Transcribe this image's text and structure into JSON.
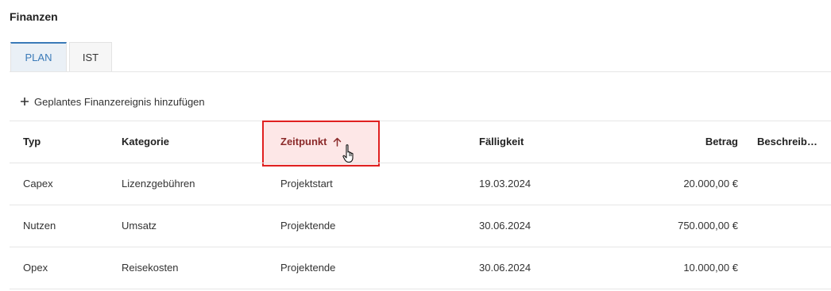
{
  "section": {
    "title": "Finanzen"
  },
  "tabs": [
    {
      "label": "PLAN",
      "active": true
    },
    {
      "label": "IST",
      "active": false
    }
  ],
  "toolbar": {
    "add_label": "Geplantes Finanzereignis hinzufügen",
    "add_icon": "plus-icon"
  },
  "table": {
    "columns": [
      {
        "label": "Typ"
      },
      {
        "label": "Kategorie"
      },
      {
        "label": "Zeitpunkt",
        "sort": "ascending",
        "sort_icon": "arrow-up-icon"
      },
      {
        "label": "Fälligkeit"
      },
      {
        "label": "Betrag"
      },
      {
        "label": "Beschreib…"
      }
    ],
    "rows": [
      {
        "typ": "Capex",
        "kategorie": "Lizenzgebühren",
        "zeitpunkt": "Projektstart",
        "faelligkeit": "19.03.2024",
        "betrag": "20.000,00 €",
        "beschreibung": ""
      },
      {
        "typ": "Nutzen",
        "kategorie": "Umsatz",
        "zeitpunkt": "Projektende",
        "faelligkeit": "30.06.2024",
        "betrag": "750.000,00 €",
        "beschreibung": ""
      },
      {
        "typ": "Opex",
        "kategorie": "Reisekosten",
        "zeitpunkt": "Projektende",
        "faelligkeit": "30.06.2024",
        "betrag": "10.000,00 €",
        "beschreibung": ""
      }
    ]
  },
  "colors": {
    "accent": "#3a7ab8",
    "highlight_border": "#e02020",
    "highlight_fill": "#fde7e7",
    "sorted_header_text": "#8b2a2a"
  },
  "cursor": {
    "icon": "hand-pointer-icon"
  }
}
